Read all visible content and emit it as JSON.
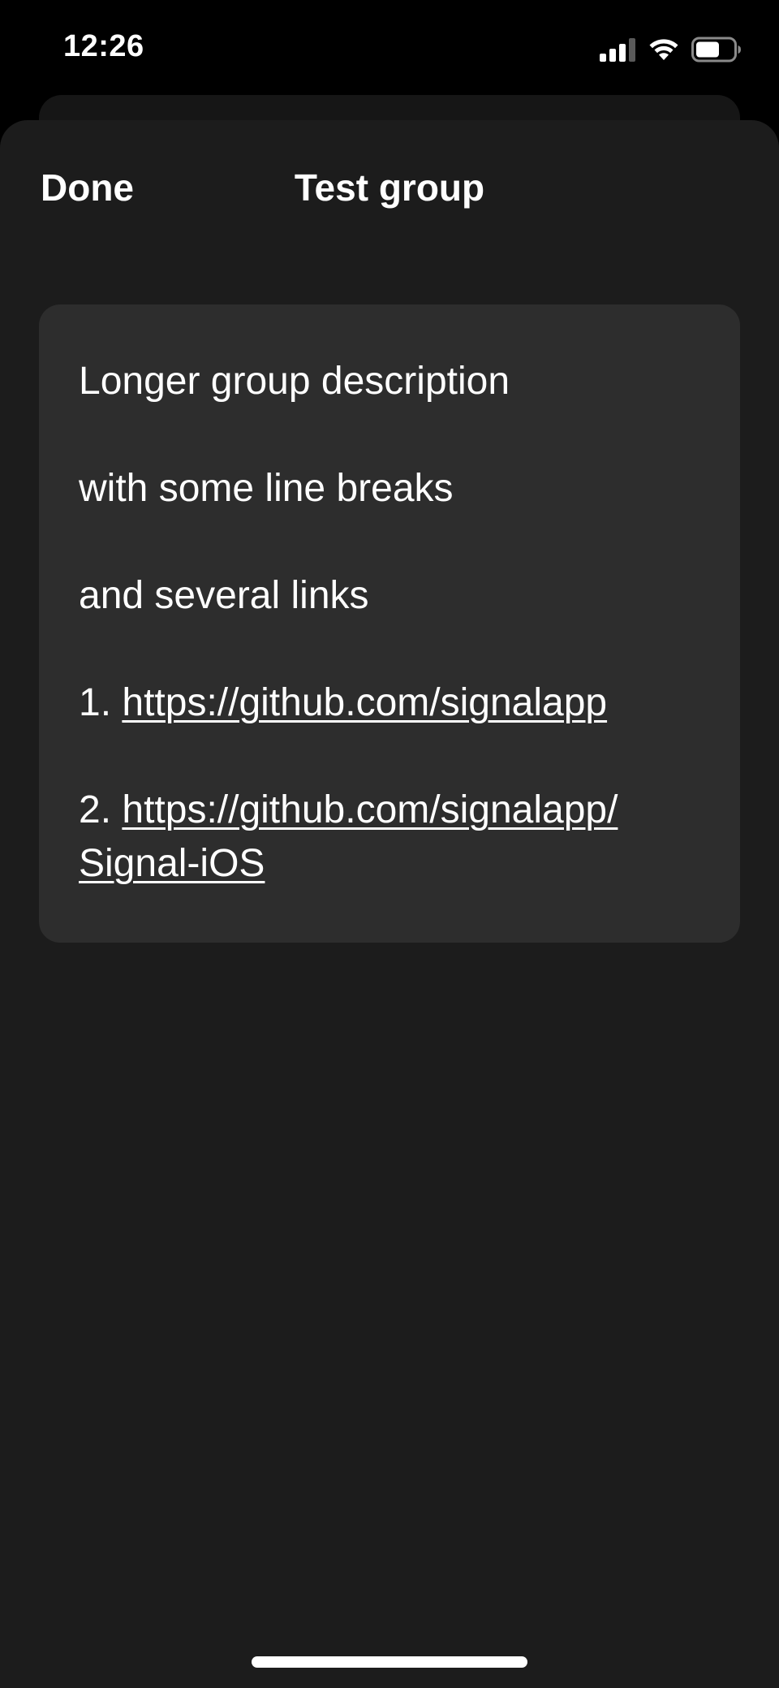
{
  "status_bar": {
    "time": "12:26",
    "icons": [
      "signal-icon",
      "wifi-icon",
      "battery-icon"
    ]
  },
  "sheet": {
    "done_label": "Done",
    "title": "Test group"
  },
  "description": {
    "line1": "Longer group description",
    "line2": "with some line breaks",
    "line3": "and several links",
    "item1_prefix": "1. ",
    "item1_link": "https://github.com/signalapp",
    "item2_prefix": "2. ",
    "item2_link_part1": "https://github.com/signalapp/",
    "item2_link_part2": "Signal-iOS"
  },
  "colors": {
    "background": "#000000",
    "sheet": "#1c1c1c",
    "card": "#2d2d2d",
    "text": "#ffffff"
  }
}
